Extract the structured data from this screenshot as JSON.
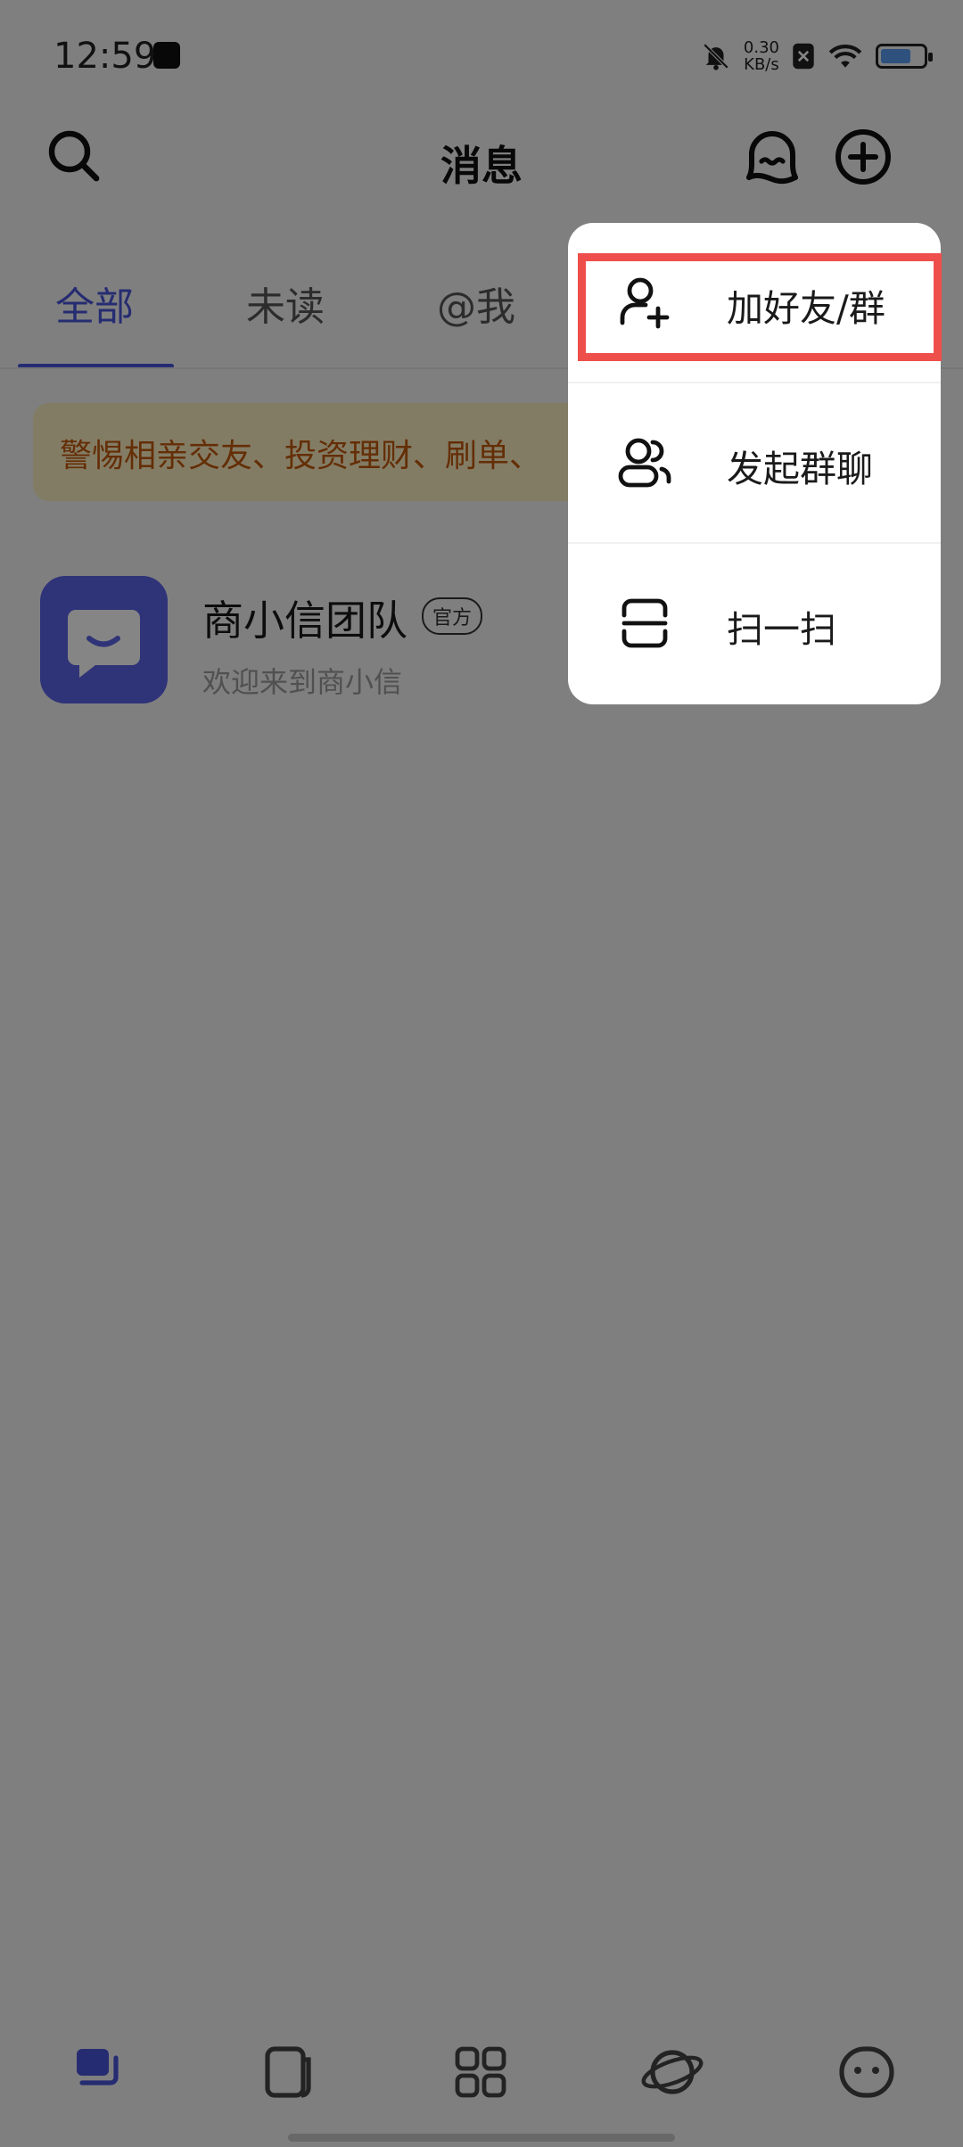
{
  "status_bar": {
    "time": "12:59",
    "net_speed_value": "0.30",
    "net_speed_unit": "KB/s",
    "battery_level": 0.72
  },
  "header": {
    "title": "消息"
  },
  "tabs": [
    {
      "label": "全部",
      "active": true
    },
    {
      "label": "未读",
      "active": false
    },
    {
      "label": "@我",
      "active": false
    }
  ],
  "warning_banner": {
    "text": "警惕相亲交友、投资理财、刷单、"
  },
  "conversation": {
    "name": "商小信团队",
    "badge": "官方",
    "preview": "欢迎来到商小信"
  },
  "popup_menu": {
    "items": [
      {
        "label": "加好友/群",
        "icon": "add-person-icon",
        "highlighted": true
      },
      {
        "label": "发起群聊",
        "icon": "group-icon",
        "highlighted": false
      },
      {
        "label": "扫一扫",
        "icon": "scan-icon",
        "highlighted": false
      }
    ]
  },
  "bottom_nav": {
    "icons": [
      "messages-icon",
      "contacts-icon",
      "apps-icon",
      "planet-icon",
      "profile-icon"
    ],
    "active_index": 0
  },
  "colors": {
    "accent": "#4a55d9",
    "highlight_border": "#ef4f4a",
    "warning_text": "#c0590c",
    "warning_bg": "#fbeec1"
  }
}
